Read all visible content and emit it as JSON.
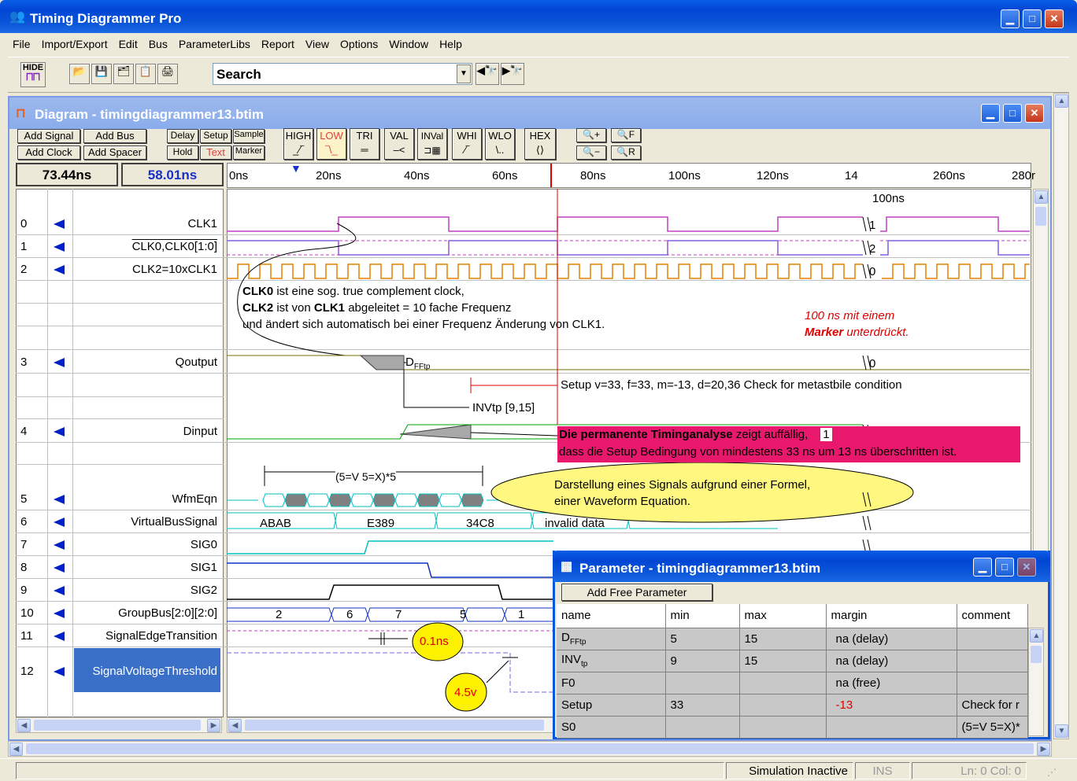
{
  "app": {
    "title": "Timing Diagrammer Pro"
  },
  "menu": [
    "File",
    "Import/Export",
    "Edit",
    "Bus",
    "ParameterLibs",
    "Report",
    "View",
    "Options",
    "Window",
    "Help"
  ],
  "toolbar": {
    "hide_label": "HIDE",
    "search_value": "Search"
  },
  "diagram": {
    "title": "Diagram - timingdiagrammer13.btim",
    "buttons": {
      "add_signal": "Add Signal",
      "add_bus": "Add Bus",
      "add_clock": "Add Clock",
      "add_spacer": "Add Spacer",
      "delay": "Delay",
      "setup": "Setup",
      "sample": "Sample",
      "hold": "Hold",
      "text": "Text",
      "marker": "Marker",
      "high": "HIGH",
      "low": "LOW",
      "tri": "TRI",
      "val": "VAL",
      "inval": "INVal",
      "whi": "WHI",
      "wlo": "WLO",
      "hex": "HEX",
      "zoom_in": "+",
      "zoom_out": "−",
      "zoom_f": "F",
      "zoom_r": "R"
    },
    "time_left": "73.44ns",
    "time_right": "58.01ns",
    "ruler": [
      "0ns",
      "20ns",
      "40ns",
      "60ns",
      "80ns",
      "100ns",
      "120ns",
      "14",
      "260ns",
      "280r"
    ],
    "break_label": "100ns",
    "signals": [
      {
        "num": "0",
        "name": "CLK1"
      },
      {
        "num": "1",
        "name": "CLK0,CLK0[1:0]"
      },
      {
        "num": "2",
        "name": "CLK2=10xCLK1"
      },
      {
        "num": "3",
        "name": "Qoutput"
      },
      {
        "num": "4",
        "name": "Dinput"
      },
      {
        "num": "5",
        "name": "WfmEqn"
      },
      {
        "num": "6",
        "name": "VirtualBusSignal"
      },
      {
        "num": "7",
        "name": "SIG0"
      },
      {
        "num": "8",
        "name": "SIG1"
      },
      {
        "num": "9",
        "name": "SIG2"
      },
      {
        "num": "10",
        "name": "GroupBus[2:0][2:0]"
      },
      {
        "num": "11",
        "name": "SignalEdgeTransition"
      },
      {
        "num": "12",
        "name": "SignalVoltageThreshold"
      }
    ],
    "break_values": {
      "clk1": "1",
      "clk0": "2",
      "clk2": "0",
      "qout": "0",
      "dinput": "1"
    },
    "note1": {
      "l1b": "CLK0",
      "l1": " ist eine sog. true complement clock,",
      "l2b": "CLK2",
      "l2": " ist von ",
      "l2c": "CLK1",
      "l2d": " abgeleitet = 10 fache Frequenz",
      "l3": "und ändert sich automatisch bei einer Frequenz Änderung von CLK1."
    },
    "note2": {
      "l1": "100 ns mit einem",
      "l2b": "Marker",
      "l2": " unterdrückt."
    },
    "dfftp": "D",
    "dfftp_sub": "FFtp",
    "setup_text": "Setup v=33, f=33, m=-13, d=20,36 Check for metastbile condition",
    "invtp_text": "INVtp [9,15]",
    "warn": {
      "l1b": "Die permanente Timinganalyse",
      "l1": " zeigt auffällig,",
      "l2": "dass die Setup Bedingung von mindestens 33 ns um 13 ns überschritten ist."
    },
    "formula": "(5=V 5=X)*5",
    "ellipse": {
      "l1": "Darstellung eines Signals aufgrund einer Formel,",
      "l2": "einer Waveform Equation."
    },
    "bus_values": [
      "ABAB",
      "E389",
      "34C8",
      "invalid data"
    ],
    "group_values": [
      "2",
      "6",
      "7",
      "5",
      "1"
    ],
    "edge_label": "0.1ns",
    "volt_label": "4.5v"
  },
  "param": {
    "title": "Parameter - timingdiagrammer13.btim",
    "add_button": "Add Free Parameter",
    "headers": [
      "name",
      "min",
      "max",
      "margin",
      "comment"
    ],
    "rows": [
      {
        "name": "D",
        "sub": "FFtp",
        "min": "5",
        "max": "15",
        "margin": "na (delay)",
        "comment": ""
      },
      {
        "name": "INV",
        "sub": "tp",
        "min": "9",
        "max": "15",
        "margin": "na (delay)",
        "comment": ""
      },
      {
        "name": "F0",
        "sub": "",
        "min": "",
        "max": "",
        "margin": "na (free)",
        "comment": ""
      },
      {
        "name": "Setup",
        "sub": "",
        "min": "33",
        "max": "",
        "margin": "-13",
        "comment": "Check for r"
      },
      {
        "name": "S0",
        "sub": "",
        "min": "",
        "max": "",
        "margin": "",
        "comment": "(5=V 5=X)*"
      }
    ]
  },
  "status": {
    "state": "Simulation Inactive",
    "ins": "INS",
    "pos": "Ln: 0  Col: 0"
  },
  "colors": {
    "clk1": "#c040c0",
    "clk0": "#8060e0",
    "clk2": "#e08000",
    "warn_bg": "#e8186c",
    "marker": "#e00000"
  }
}
